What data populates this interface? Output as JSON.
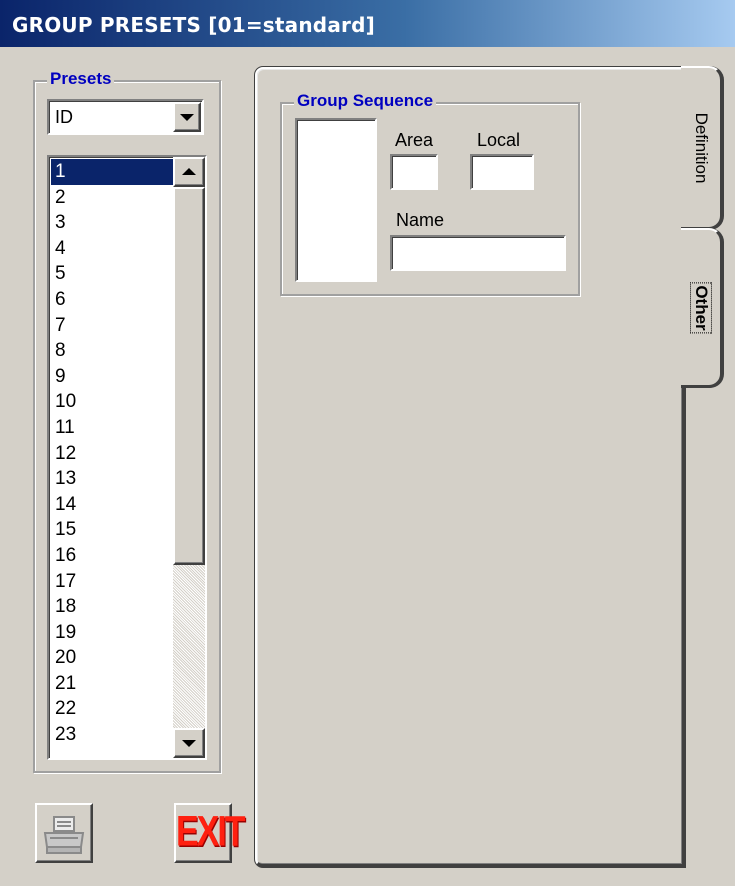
{
  "window": {
    "title": "GROUP PRESETS  [01=standard]"
  },
  "presets": {
    "legend": "Presets",
    "combo_value": "ID",
    "items": [
      "1",
      "2",
      "3",
      "4",
      "5",
      "6",
      "7",
      "8",
      "9",
      "10",
      "11",
      "12",
      "13",
      "14",
      "15",
      "16",
      "17",
      "18",
      "19",
      "20",
      "21",
      "22",
      "23"
    ],
    "selected_index": 0
  },
  "tabs": {
    "definition_label": "Definition",
    "other_label": "Other",
    "active": "Other"
  },
  "group_sequence": {
    "legend": "Group Sequence",
    "area_label": "Area",
    "local_label": "Local",
    "name_label": "Name",
    "area_value": "",
    "local_value": "",
    "name_value": ""
  },
  "buttons": {
    "exit_label": "EXIT",
    "print_icon": "printer-icon"
  },
  "colors": {
    "title_gradient_start": "#0a246a",
    "legend_blue": "#0000c0",
    "selection": "#0a246a",
    "exit_red": "#ff2010"
  }
}
